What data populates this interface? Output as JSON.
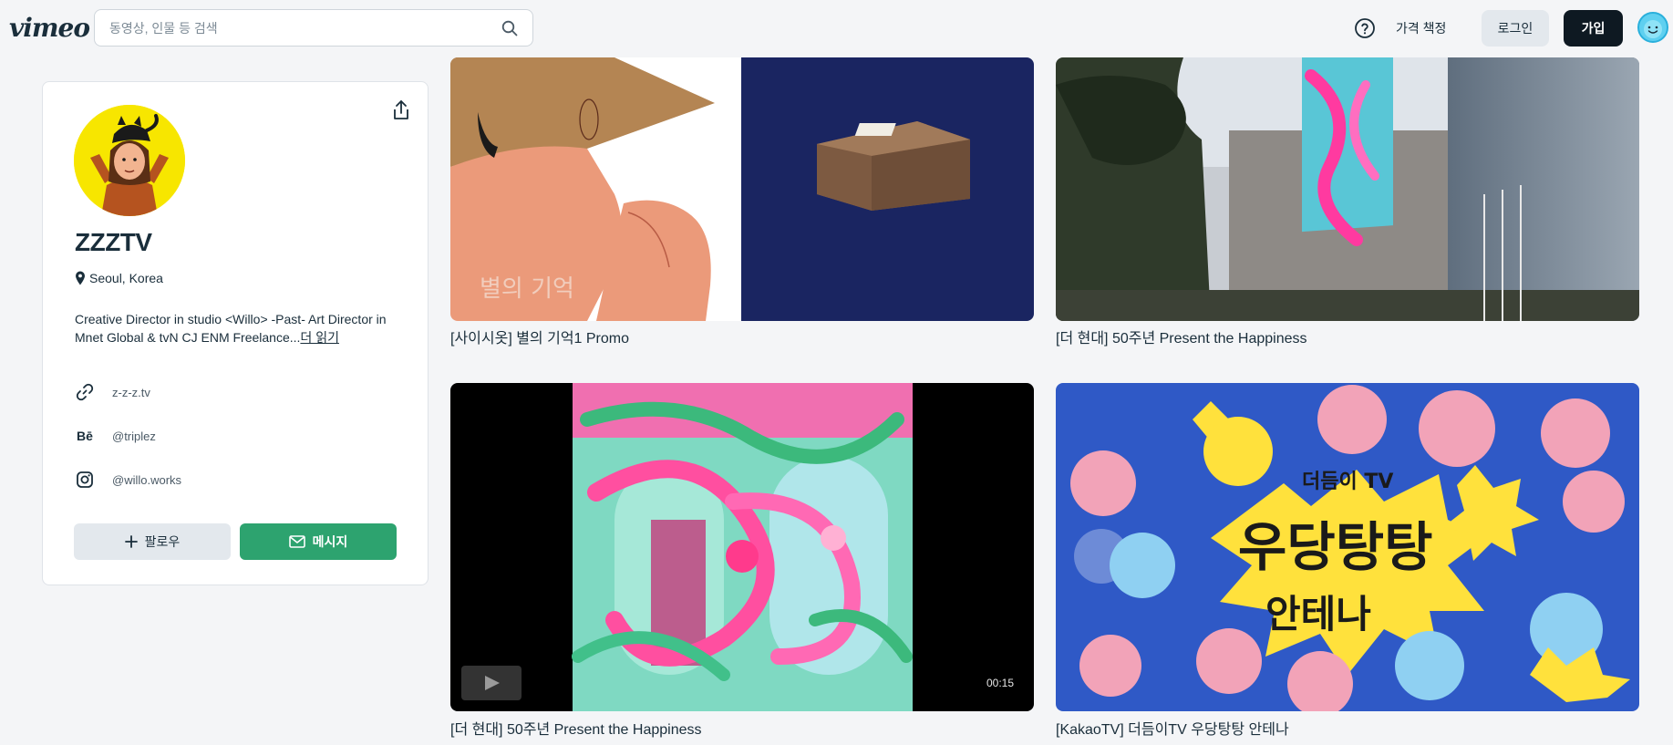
{
  "header": {
    "logo": "vimeo",
    "search_placeholder": "동영상, 인물 등 검색",
    "pricing": "가격 책정",
    "login": "로그인",
    "join": "가입"
  },
  "profile": {
    "name": "ZZZTV",
    "location": "Seoul, Korea",
    "bio": "Creative Director in studio <Willo> -Past- Art Director in Mnet Global & tvN CJ ENM Freelance...",
    "bio_more": "더 읽기",
    "links": [
      {
        "icon": "link-icon",
        "text": "z-z-z.tv"
      },
      {
        "icon": "behance-icon",
        "icon_text": "Bē",
        "text": "@triplez"
      },
      {
        "icon": "instagram-icon",
        "text": "@willo.works"
      }
    ],
    "follow_label": "팔로우",
    "message_label": "메시지",
    "accent": "#2da36f"
  },
  "videos": [
    {
      "title": "[사이시옷] 별의 기억1 Promo",
      "thumb_text": "별의 기억"
    },
    {
      "title": "[더 현대] 50주년 Present the Happiness"
    },
    {
      "title": "[더 현대] 50주년 Present the Happiness",
      "duration": "00:15"
    },
    {
      "title": "[KakaoTV] 더듬이TV 우당탕탕 안테나",
      "thumb_text_1": "더듬이 TV",
      "thumb_text_2": "우당탕탕",
      "thumb_text_3": "안테나"
    }
  ]
}
